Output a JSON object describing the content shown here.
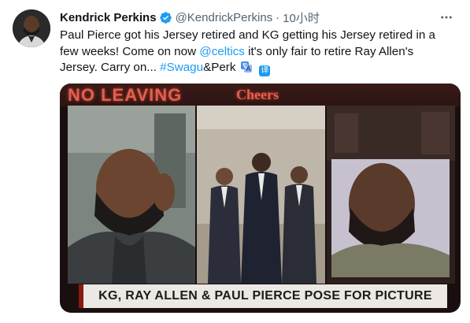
{
  "tweet": {
    "display_name": "Kendrick Perkins",
    "handle": "@KendrickPerkins",
    "separator": "·",
    "time": "10小时",
    "text_before_mention": "Paul Pierce got his Jersey retired and KG getting his Jersey retired in a few weeks! Come on now ",
    "mention": "@celtics",
    "text_after_mention": " it's only fair to retire Ray Allen's Jersey. Carry on... ",
    "hashtag": "#Swagu",
    "text_after_hashtag": "&Perk",
    "translate_chip_glyph": "译",
    "colors": {
      "link": "#1d9bf0",
      "verified": "#1d9bf0",
      "text": "#0f1419",
      "secondary": "#536471"
    },
    "icons": {
      "verified": "verified-badge-icon",
      "more": "more-horizontal-icon",
      "translate": "translate-icon"
    }
  },
  "media": {
    "sign_left": "NO LEAVING",
    "sign_right": "Cheers",
    "banner": "KG, RAY ALLEN & PAUL PIERCE POSE FOR PICTURE",
    "colors": {
      "banner_accent": "#8b1a15",
      "banner_bg": "#ece8e4",
      "neon": "#e0604f"
    }
  }
}
